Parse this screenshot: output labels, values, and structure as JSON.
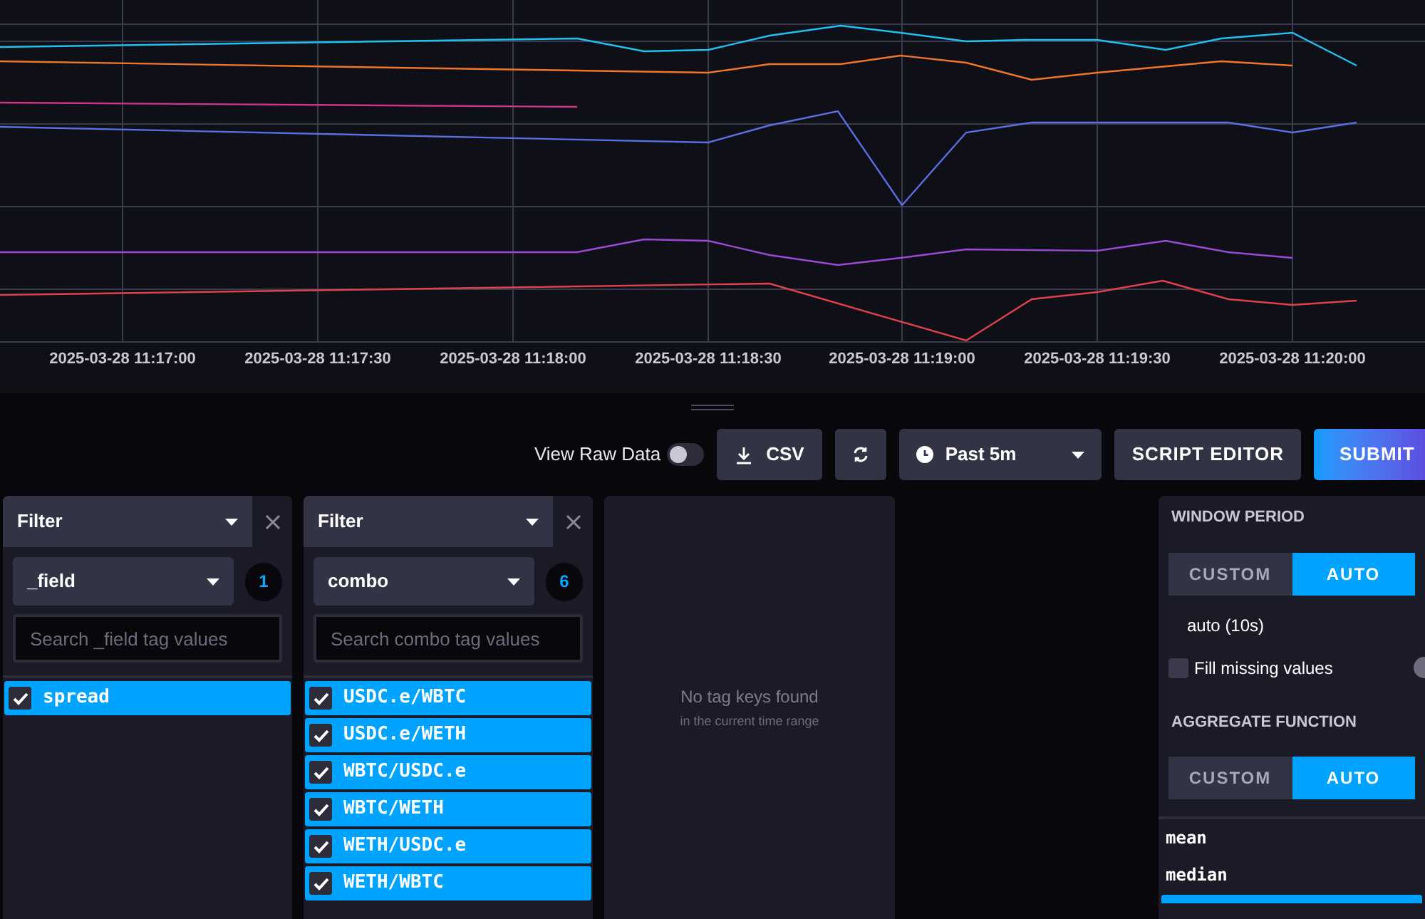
{
  "chart": {
    "x_axis_labels": [
      "2025-03-28 11:17:00",
      "2025-03-28 11:17:30",
      "2025-03-28 11:18:00",
      "2025-03-28 11:18:30",
      "2025-03-28 11:19:00",
      "2025-03-28 11:19:30",
      "2025-03-28 11:20:00"
    ]
  },
  "toolbar": {
    "raw_data_toggle": {
      "label": "View Raw Data",
      "on": false
    },
    "csv_button": "CSV",
    "time_range": "Past 5m",
    "script_editor_button": "SCRIPT EDITOR",
    "submit_button": "SUBMIT"
  },
  "filters": [
    {
      "title": "Filter",
      "key": "_field",
      "count": "1",
      "search_placeholder": "Search _field tag values",
      "values": [
        {
          "label": "spread",
          "checked": true
        }
      ]
    },
    {
      "title": "Filter",
      "key": "combo",
      "count": "6",
      "search_placeholder": "Search combo tag values",
      "values": [
        {
          "label": "USDC.e/WBTC",
          "checked": true
        },
        {
          "label": "USDC.e/WETH",
          "checked": true
        },
        {
          "label": "WBTC/USDC.e",
          "checked": true
        },
        {
          "label": "WBTC/WETH",
          "checked": true
        },
        {
          "label": "WETH/USDC.e",
          "checked": true
        },
        {
          "label": "WETH/WBTC",
          "checked": true
        }
      ]
    }
  ],
  "empty_panel": {
    "message": "No tag keys found",
    "hint": "in the current time range"
  },
  "aggregation": {
    "window_period": {
      "title": "WINDOW PERIOD",
      "options": [
        {
          "label": "CUSTOM",
          "selected": false
        },
        {
          "label": "AUTO",
          "selected": true
        }
      ],
      "value": "auto (10s)",
      "fill_missing": {
        "label": "Fill missing values",
        "checked": false
      }
    },
    "aggregate_function": {
      "title": "AGGREGATE FUNCTION",
      "options": [
        {
          "label": "CUSTOM",
          "selected": false
        },
        {
          "label": "AUTO",
          "selected": true
        }
      ],
      "functions": [
        {
          "label": "mean",
          "selected": false
        },
        {
          "label": "median",
          "selected": false
        }
      ]
    }
  }
}
